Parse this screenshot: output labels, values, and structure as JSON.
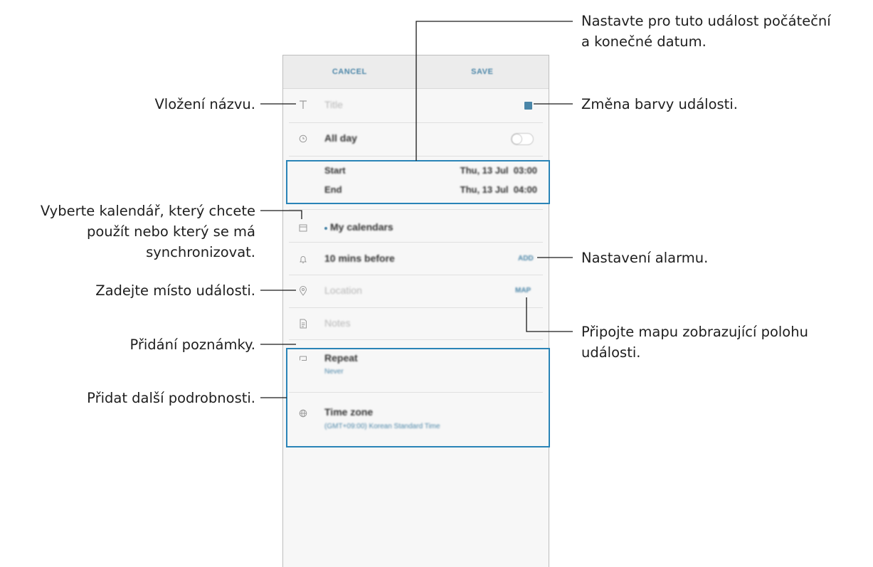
{
  "header": {
    "cancel_label": "CANCEL",
    "save_label": "SAVE"
  },
  "form": {
    "title_placeholder": "Title",
    "all_day_label": "All day",
    "all_day_enabled": false,
    "start_label": "Start",
    "start_value": "Thu, 13 Jul  03:00",
    "end_label": "End",
    "end_value": "Thu, 13 Jul  04:00",
    "calendar_label": "My calendars",
    "alarm_label": "10 mins before",
    "alarm_add": "ADD",
    "location_placeholder": "Location",
    "map_label": "MAP",
    "notes_placeholder": "Notes",
    "repeat_label": "Repeat",
    "repeat_value": "Never",
    "timezone_label": "Time zone",
    "timezone_value": "(GMT+09:00) Korean Standard Time",
    "event_color": "#4a86a8"
  },
  "callouts": {
    "title": "Vložení názvu.",
    "dates_line1": "Nastavte pro tuto událost počáteční",
    "dates_line2": "a konečné datum.",
    "color": "Změna barvy události.",
    "calendar_line1": "Vyberte kalendář, který chcete",
    "calendar_line2": "použít nebo který se má",
    "calendar_line3": "synchronizovat.",
    "alarm": "Nastavení alarmu.",
    "location": "Zadejte místo události.",
    "map_line1": "Připojte mapu zobrazující polohu",
    "map_line2": "události.",
    "note": "Přidání poznámky.",
    "details": "Přidat další podrobnosti."
  },
  "colors": {
    "accent": "#4a86a8",
    "callout_line": "#1a1a1a",
    "highlight_box": "#2a84b7"
  },
  "icons": {
    "title": "text-icon",
    "all_day": "clock-icon",
    "calendar": "calendar-icon",
    "alarm": "bell-icon",
    "location": "location-pin-icon",
    "notes": "note-icon",
    "repeat": "repeat-icon",
    "timezone": "globe-icon"
  }
}
